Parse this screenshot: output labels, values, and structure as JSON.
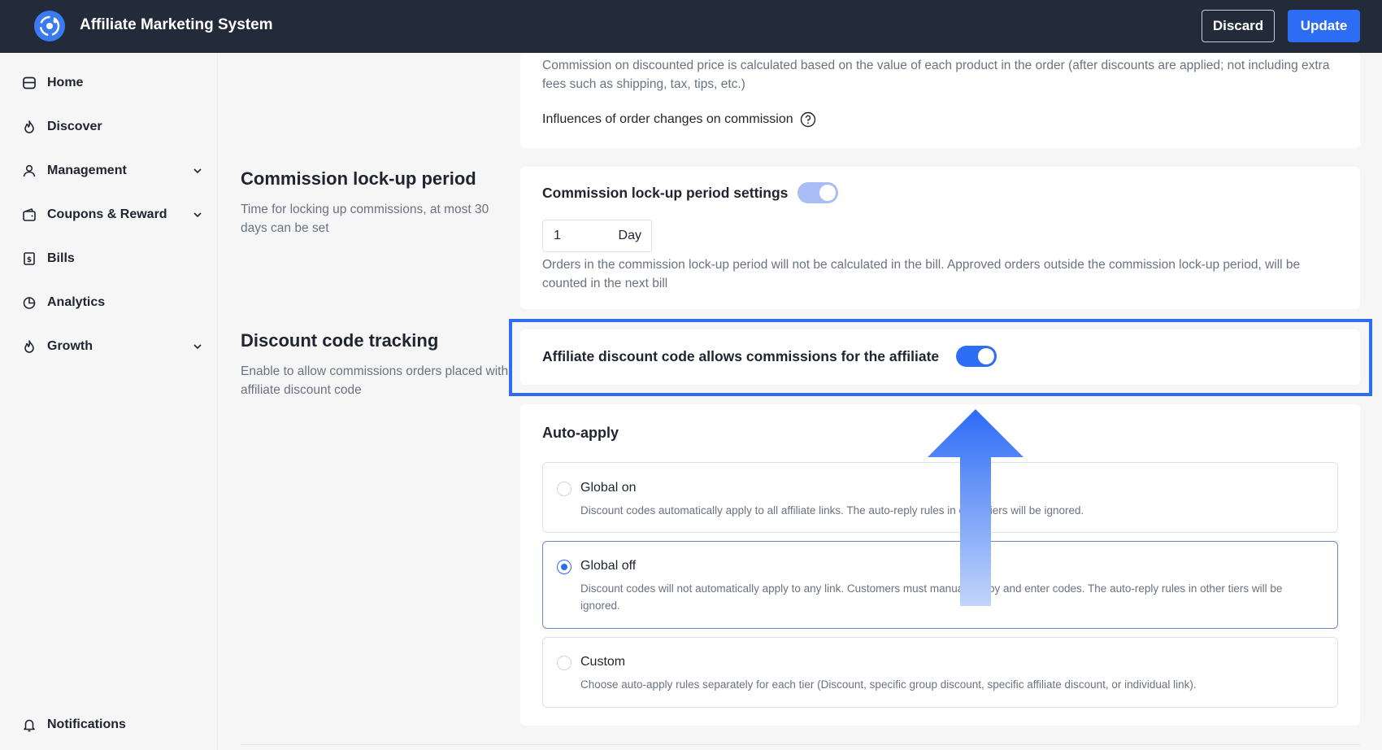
{
  "header": {
    "app_title": "Affiliate Marketing System",
    "discard_label": "Discard",
    "update_label": "Update",
    "logo_icon": "logo-icon"
  },
  "sidebar": {
    "items": [
      {
        "label": "Home",
        "icon": "home-icon"
      },
      {
        "label": "Discover",
        "icon": "flame-icon"
      },
      {
        "label": "Management",
        "icon": "user-icon",
        "expandable": true
      },
      {
        "label": "Coupons & Reward",
        "icon": "wallet-icon",
        "expandable": true
      },
      {
        "label": "Bills",
        "icon": "bill-icon"
      },
      {
        "label": "Analytics",
        "icon": "pie-chart-icon"
      },
      {
        "label": "Growth",
        "icon": "flame-icon",
        "expandable": true
      }
    ],
    "notifications_label": "Notifications"
  },
  "commission_card": {
    "description": "Commission on discounted price is calculated based on the value of each product in the order (after discounts are applied; not including extra fees such as shipping, tax, tips, etc.)",
    "influence_label": "Influences of order changes on commission"
  },
  "lockup": {
    "title": "Commission lock-up period",
    "description": "Time for locking up commissions, at most 30 days can be set",
    "settings_label": "Commission lock-up period settings",
    "toggle_on": true,
    "value": "1",
    "unit": "Day",
    "note": "Orders in the commission lock-up period will not be calculated in the bill. Approved orders outside the commission lock-up period, will be counted in the next bill"
  },
  "discount_tracking": {
    "title": "Discount code tracking",
    "description": "Enable to allow commissions orders placed with affiliate discount code",
    "toggle_label": "Affiliate discount code allows commissions for the affiliate",
    "toggle_on": true
  },
  "auto_apply": {
    "title": "Auto-apply",
    "options": [
      {
        "title": "Global on",
        "description": "Discount codes automatically apply to all affiliate links. The auto-reply rules in other tiers will be ignored.",
        "selected": false
      },
      {
        "title": "Global off",
        "description": "Discount codes will not automatically apply to any link. Customers must manually copy and enter codes. The auto-reply rules in other tiers will be ignored.",
        "selected": true
      },
      {
        "title": "Custom",
        "description": "Choose auto-apply rules separately for each tier (Discount, specific group discount, specific affiliate discount, or individual link).",
        "selected": false
      }
    ]
  },
  "colors": {
    "topbar": "#232b3a",
    "accent": "#2d6cf5",
    "toggle_light": "#a9bdf5"
  }
}
